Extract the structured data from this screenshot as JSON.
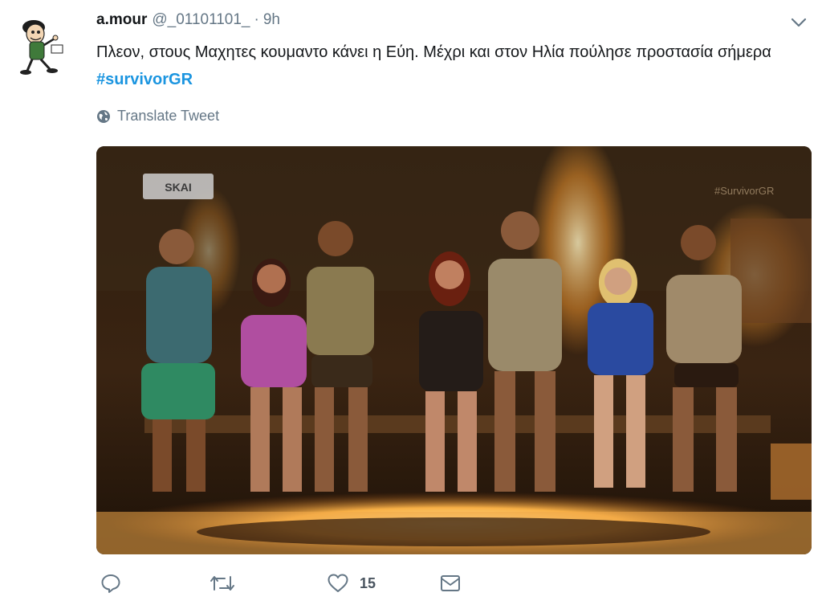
{
  "tweet": {
    "name": "a.mour",
    "handle": "@_01101101_",
    "separator": "·",
    "time": "9h",
    "text_main": "Πλεον, στους Μαχητες κουμαντο κάνει η Εύη. Μέχρι και στον Ηλία πούλησε προστασία σήμερα ",
    "hashtag": "#survivorGR",
    "translate_label": "Translate Tweet",
    "media": {
      "channel_logo": "SKAI",
      "watermark": "#SurvivorGR"
    },
    "actions": {
      "reply_icon": "reply-icon",
      "retweet_icon": "retweet-icon",
      "like_icon": "heart-icon",
      "like_count": "15",
      "dm_icon": "envelope-icon"
    }
  },
  "colors": {
    "link": "#1b95e0",
    "muted": "#657786",
    "text": "#14171a"
  }
}
